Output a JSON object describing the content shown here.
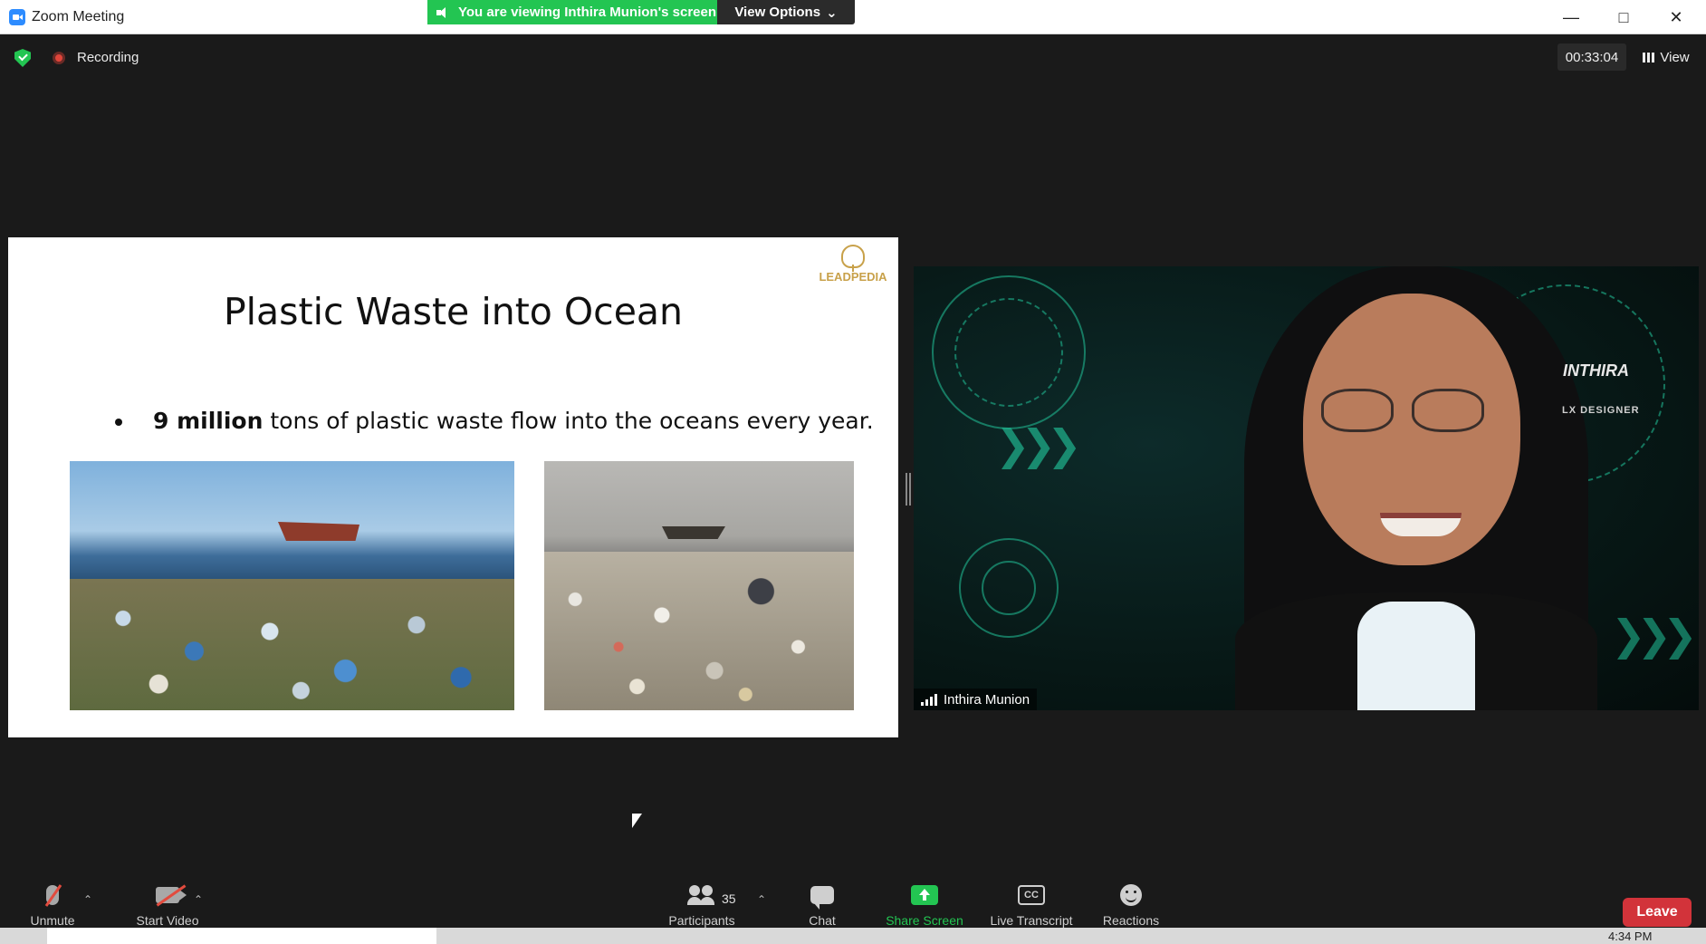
{
  "window": {
    "title": "Zoom Meeting",
    "minimize_icon": "minimize-icon",
    "maximize_icon": "maximize-icon",
    "close_icon": "close-icon"
  },
  "share_banner": {
    "text": "You are viewing Inthira Munion's screen",
    "view_options_label": "View Options",
    "color": "#23c552"
  },
  "meeting_bar": {
    "recording_label": "Recording",
    "timer": "00:33:04",
    "view_label": "View"
  },
  "slide": {
    "title": "Plastic Waste into Ocean",
    "bullet_bold": "9 million",
    "bullet_rest": " tons of plastic waste flow into the oceans every year.",
    "logo_text": "LEADPEDIA"
  },
  "video": {
    "participant_name": "Inthira Munion",
    "background_name": "INTHIRA",
    "background_role": "LX DESIGNER"
  },
  "toolbar": {
    "unmute_label": "Unmute",
    "start_video_label": "Start Video",
    "participants_label": "Participants",
    "participants_count": "35",
    "chat_label": "Chat",
    "share_screen_label": "Share Screen",
    "live_transcript_label": "Live Transcript",
    "cc_text": "CC",
    "reactions_label": "Reactions",
    "leave_label": "Leave",
    "leave_color": "#d2333a"
  },
  "taskbar": {
    "clock": "4:34 PM"
  }
}
